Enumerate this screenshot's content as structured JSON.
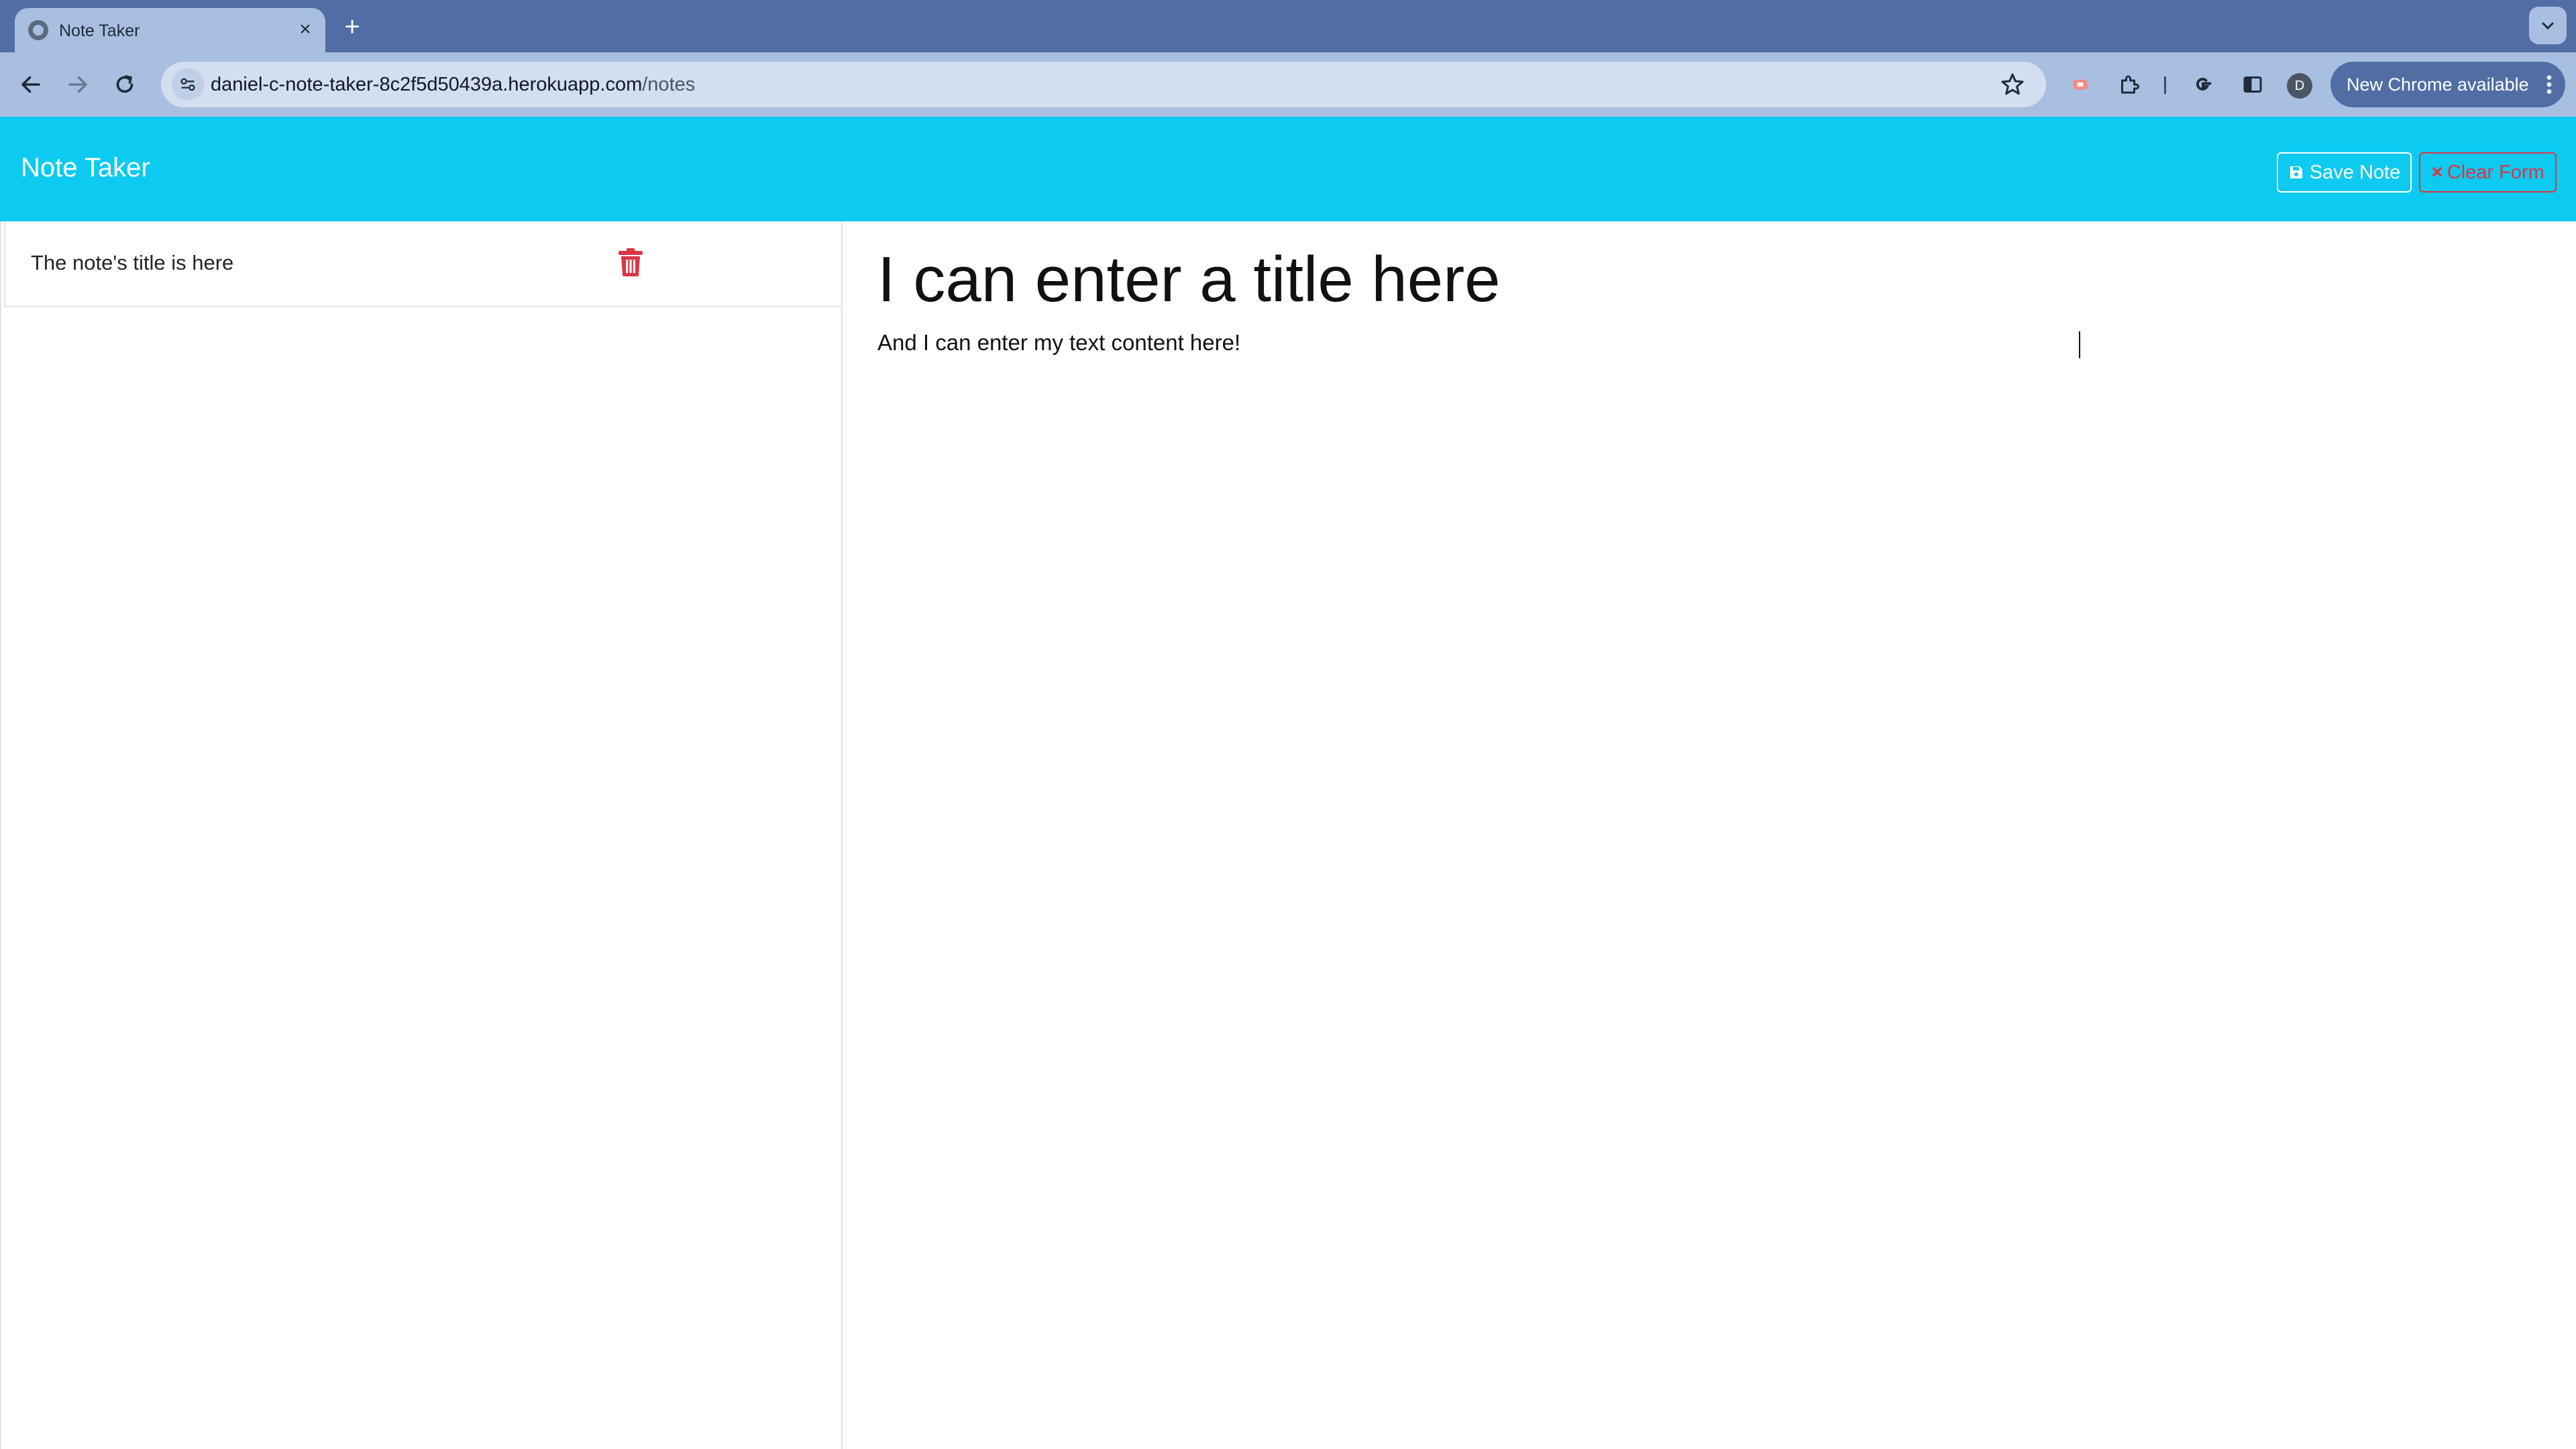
{
  "browser": {
    "tab": {
      "title": "Note Taker",
      "favicon": "globe-icon",
      "close_icon": "×"
    },
    "new_tab_icon": "+",
    "address_bar": {
      "host": "daniel-c-note-taker-8c2f5d50439a.herokuapp.com",
      "path": "/notes"
    },
    "profile_initial": "D",
    "update_label": "New Chrome available",
    "icons": [
      "back-icon",
      "forward-icon",
      "reload-icon",
      "site-info-icon",
      "bookmark-star-icon",
      "extension-badge-icon",
      "puzzle-extensions-icon",
      "google-icon",
      "side-panel-icon",
      "profile-avatar-icon",
      "more-menu-icon",
      "tab-search-icon"
    ]
  },
  "app": {
    "brand": "Note Taker",
    "header_color": "#0dcaf0",
    "actions": {
      "save_label": "Save Note",
      "save_icon": "floppy-disk-icon",
      "clear_label": "Clear Form",
      "clear_icon": "×",
      "clear_color": "#dc3545"
    }
  },
  "notes": [
    {
      "title": "The note's title is here",
      "delete_icon": "trash-icon"
    }
  ],
  "editor": {
    "title_value": "I can enter a title here",
    "text_value": "And I can enter my text content here!"
  }
}
